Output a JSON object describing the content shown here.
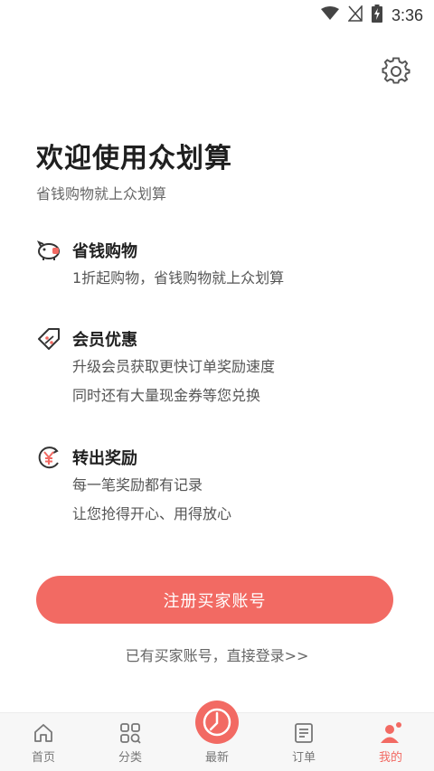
{
  "status_bar": {
    "time": "3:36"
  },
  "header": {
    "settings_icon": "gear-icon"
  },
  "welcome": {
    "title": "欢迎使用众划算",
    "subtitle": "省钱购物就上众划算"
  },
  "features": [
    {
      "icon": "piggy-bank-icon",
      "title": "省钱购物",
      "lines": [
        "1折起购物，省钱购物就上众划算"
      ]
    },
    {
      "icon": "discount-tag-icon",
      "title": "会员优惠",
      "lines": [
        "升级会员获取更快订单奖励速度",
        "同时还有大量现金券等您兑换"
      ]
    },
    {
      "icon": "yuan-reward-icon",
      "title": "转出奖励",
      "lines": [
        "每一笔奖励都有记录",
        "让您抢得开心、用得放心"
      ]
    }
  ],
  "actions": {
    "register_label": "注册买家账号",
    "login_link": "已有买家账号，直接登录>>"
  },
  "bottom_nav": {
    "items": [
      {
        "label": "首页",
        "icon": "home-icon"
      },
      {
        "label": "分类",
        "icon": "category-grid-icon"
      },
      {
        "label": "最新",
        "icon": "clock-icon"
      },
      {
        "label": "订单",
        "icon": "order-list-icon"
      },
      {
        "label": "我的",
        "icon": "user-icon",
        "active": true
      }
    ]
  },
  "colors": {
    "accent": "#f26a63"
  }
}
